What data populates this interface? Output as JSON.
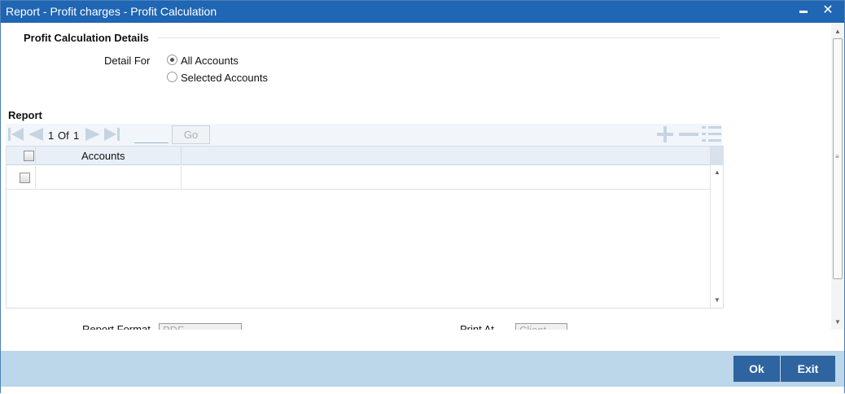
{
  "window": {
    "title": "Report - Profit charges - Profit Calculation",
    "minimize_glyph": "▬",
    "close_glyph": "✕"
  },
  "details": {
    "section_title": "Profit Calculation Details",
    "detail_for_label": "Detail For",
    "options": [
      {
        "label": "All Accounts",
        "checked": true
      },
      {
        "label": "Selected Accounts",
        "checked": false
      }
    ]
  },
  "report": {
    "title": "Report",
    "pagination": {
      "current": "1",
      "of_label": "Of",
      "total": "1",
      "go_label": "Go"
    },
    "columns": [
      "Accounts"
    ],
    "rows": [
      {
        "accounts": ""
      }
    ]
  },
  "bottom_fields": {
    "report_format_label": "Report Format",
    "report_format_value": "PDF",
    "print_at_label": "Print At",
    "print_at_value": "Client"
  },
  "footer": {
    "ok_label": "Ok",
    "exit_label": "Exit"
  },
  "colors": {
    "titlebar": "#1f66b4",
    "footer": "#bcd6ea",
    "button": "#2e64a0"
  }
}
